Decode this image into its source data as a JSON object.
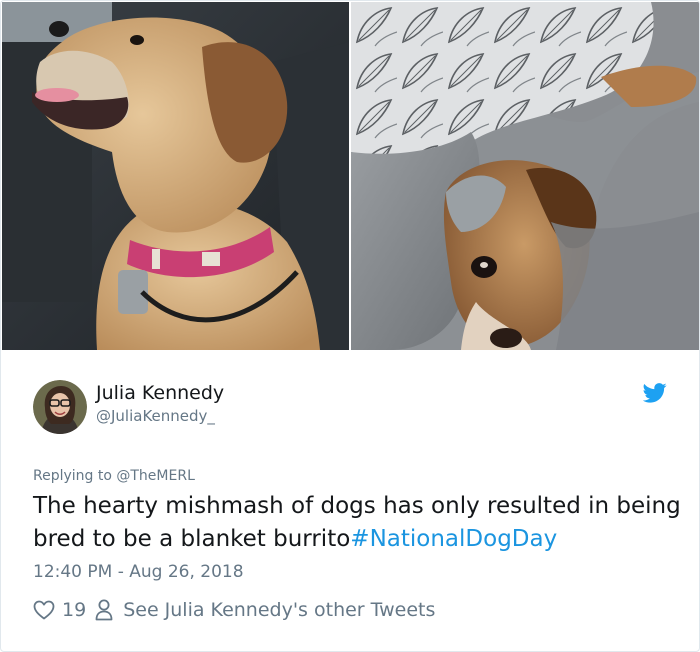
{
  "tweet": {
    "author": {
      "display_name": "Julia Kennedy",
      "handle": "@JuliaKennedy_"
    },
    "replying_to": "Replying to @TheMERL",
    "text": "The hearty mishmash of dogs has only resulted in being bred to be a blanket burrito",
    "hashtag": "#NationalDogDay",
    "timestamp": "12:40 PM - Aug 26, 2018",
    "likes": "19",
    "other_tweets_link": "See Julia Kennedy's other Tweets"
  },
  "icons": {
    "brand": "twitter-bird-icon",
    "like": "heart-icon",
    "profile": "person-icon"
  },
  "colors": {
    "link": "#1b95e0",
    "secondary_text": "#657786",
    "primary_text": "#14171a",
    "border": "#e1e8ed"
  }
}
